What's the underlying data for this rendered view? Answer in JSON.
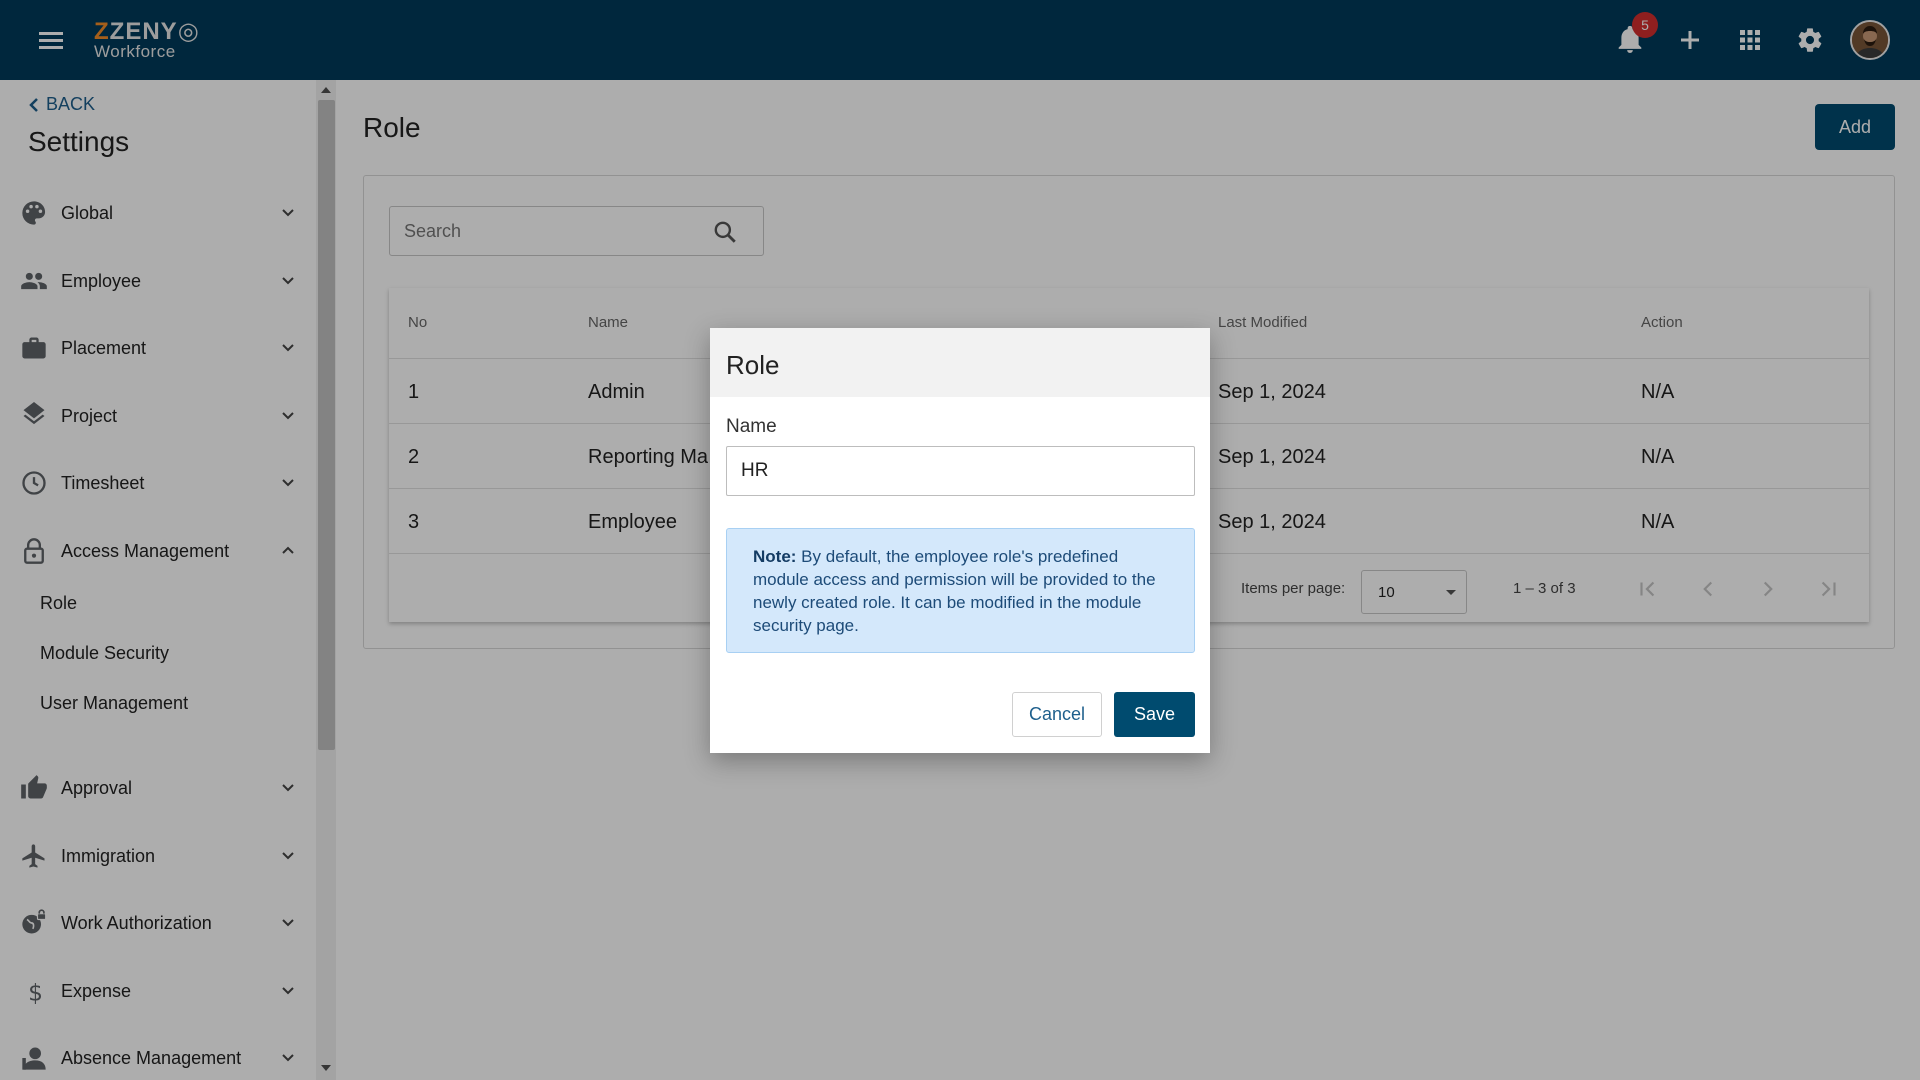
{
  "header": {
    "logo_text_1": "ZENY",
    "logo_text_2": "Workforce",
    "notification_count": "5",
    "icons": [
      "menu-icon",
      "bell-icon",
      "plus-icon",
      "apps-grid-icon",
      "gear-icon",
      "avatar"
    ]
  },
  "sidebar": {
    "back_label": "BACK",
    "title": "Settings",
    "items": [
      {
        "label": "Global",
        "icon": "palette-icon",
        "expanded": false
      },
      {
        "label": "Employee",
        "icon": "people-icon",
        "expanded": false
      },
      {
        "label": "Placement",
        "icon": "briefcase-icon",
        "expanded": false
      },
      {
        "label": "Project",
        "icon": "layers-icon",
        "expanded": false
      },
      {
        "label": "Timesheet",
        "icon": "clock-icon",
        "expanded": false
      },
      {
        "label": "Access Management",
        "icon": "lock-icon",
        "expanded": true
      },
      {
        "label": "Approval",
        "icon": "thumb-up-icon",
        "expanded": false
      },
      {
        "label": "Immigration",
        "icon": "airplane-icon",
        "expanded": false
      },
      {
        "label": "Work Authorization",
        "icon": "globe-lock-icon",
        "expanded": false
      },
      {
        "label": "Expense",
        "icon": "dollar-icon",
        "expanded": false
      },
      {
        "label": "Absence Management",
        "icon": "person-icon",
        "expanded": false
      }
    ],
    "sub_items": [
      "Role",
      "Module Security",
      "User Management"
    ]
  },
  "main": {
    "title": "Role",
    "add_label": "Add",
    "search_placeholder": "Search",
    "table": {
      "columns": [
        "No",
        "Name",
        "Last Modified",
        "Action"
      ],
      "rows": [
        {
          "no": "1",
          "name": "Admin",
          "last_modified": "Sep 1, 2024",
          "action": "N/A"
        },
        {
          "no": "2",
          "name": "Reporting Ma",
          "last_modified": "Sep 1, 2024",
          "action": "N/A"
        },
        {
          "no": "3",
          "name": "Employee",
          "last_modified": "Sep 1, 2024",
          "action": "N/A"
        }
      ]
    },
    "paginator": {
      "items_per_page_label": "Items per page:",
      "items_per_page_value": "10",
      "range": "1 – 3 of 3"
    }
  },
  "dialog": {
    "title": "Role",
    "name_label": "Name",
    "name_value": "HR",
    "note_label": "Note:",
    "note_text": " By default, the employee role's predefined module access and permission will be provided to the newly created role. It can be modified in the module security page.",
    "cancel_label": "Cancel",
    "save_label": "Save"
  },
  "colors": {
    "header_bg": "#003a5a",
    "primary_button": "#004b6f",
    "link": "#1e5f8c",
    "note_bg": "#d4e8fb",
    "badge": "#d32f2f",
    "logo_accent": "#f28c28"
  }
}
